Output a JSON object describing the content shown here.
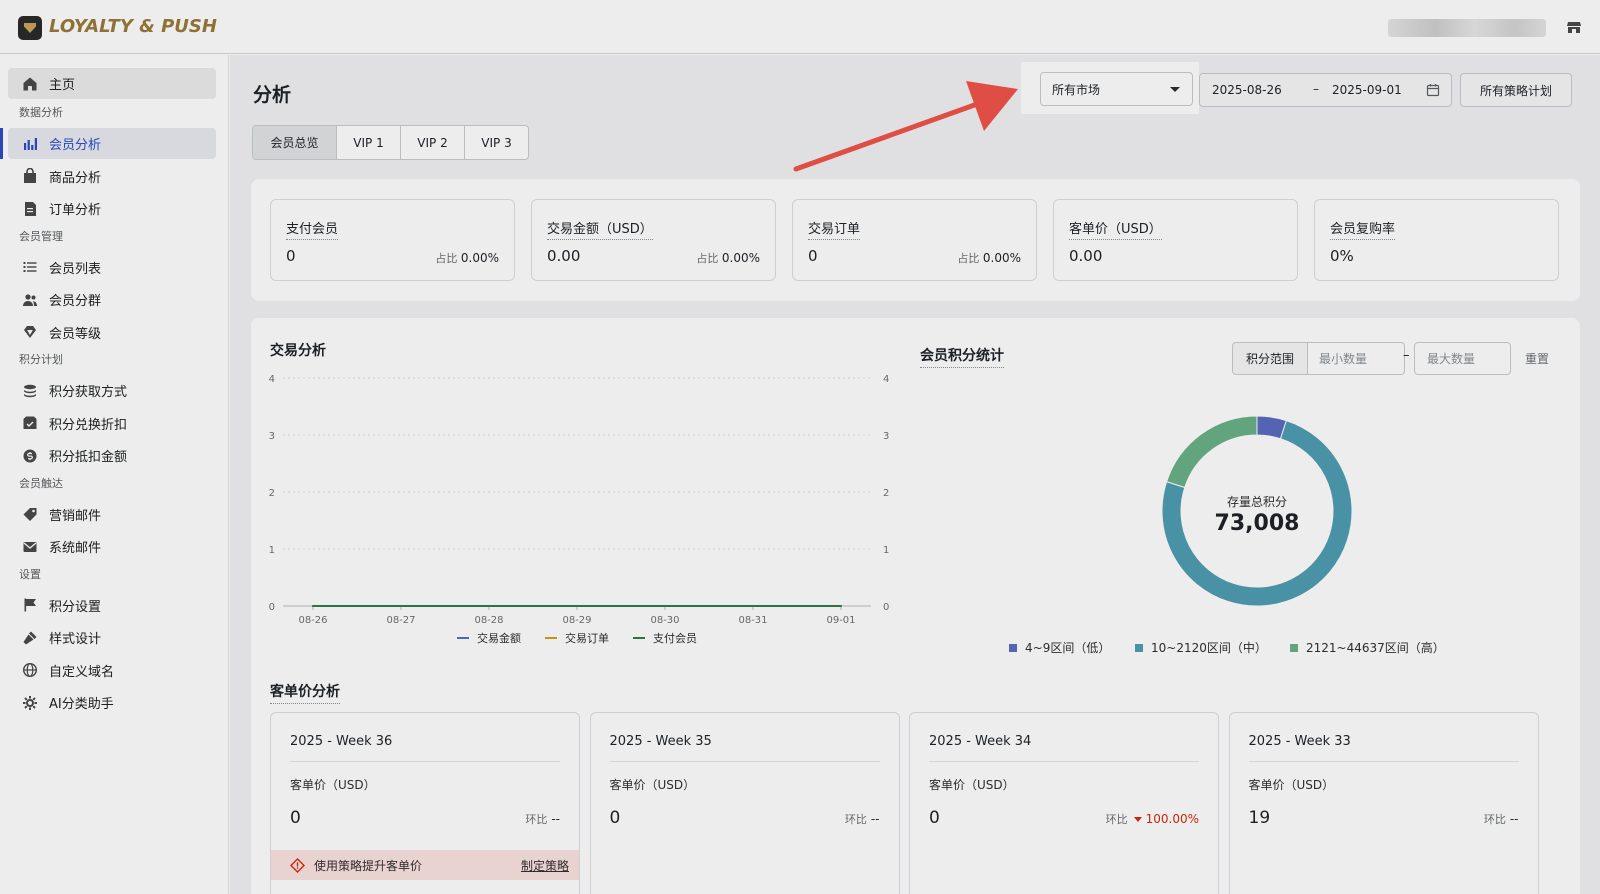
{
  "app": {
    "logo_text": "LOYALTY & PUSH"
  },
  "sidebar": {
    "home": "主页",
    "sections": [
      {
        "title": "数据分析",
        "items": [
          "会员分析",
          "商品分析",
          "订单分析"
        ]
      },
      {
        "title": "会员管理",
        "items": [
          "会员列表",
          "会员分群",
          "会员等级"
        ]
      },
      {
        "title": "积分计划",
        "items": [
          "积分获取方式",
          "积分兑换折扣",
          "积分抵扣金额"
        ]
      },
      {
        "title": "会员触达",
        "items": [
          "营销邮件",
          "系统邮件"
        ]
      },
      {
        "title": "设置",
        "items": [
          "积分设置",
          "样式设计",
          "自定义域名",
          "AI分类助手"
        ]
      }
    ],
    "active_item": "会员分析"
  },
  "header": {
    "title": "分析",
    "market_select": "所有市场",
    "date_start": "2025-08-26",
    "date_sep": "–",
    "date_end": "2025-09-01",
    "plan_button": "所有策略计划"
  },
  "tabs": [
    "会员总览",
    "VIP 1",
    "VIP 2",
    "VIP 3"
  ],
  "kpis": [
    {
      "label": "支付会员",
      "value": "0",
      "share_label": "占比",
      "share": "0.00%"
    },
    {
      "label": "交易金额（USD）",
      "value": "0.00",
      "share_label": "占比",
      "share": "0.00%"
    },
    {
      "label": "交易订单",
      "value": "0",
      "share_label": "占比",
      "share": "0.00%"
    },
    {
      "label": "客单价（USD）",
      "value": "0.00"
    },
    {
      "label": "会员复购率",
      "value": "0%"
    }
  ],
  "trade": {
    "title": "交易分析",
    "legend": [
      "交易金额",
      "交易订单",
      "支付会员"
    ],
    "colors": [
      "#5470c6",
      "#d4a017",
      "#2e7d4f"
    ]
  },
  "points": {
    "title": "会员积分统计",
    "range_label": "积分范围",
    "min_placeholder": "最小数量",
    "range_sep": "–",
    "max_placeholder": "最大数量",
    "reset": "重置",
    "center_label": "存量总积分",
    "center_value": "73,008",
    "legend": [
      "4~9区间（低）",
      "10~2120区间（中）",
      "2121~44637区间（高）"
    ],
    "colors": [
      "#5b6bc0",
      "#4f9db2",
      "#6ab187"
    ]
  },
  "aov": {
    "title": "客单价分析",
    "weeks": [
      {
        "title": "2025 - Week 36",
        "sub": "客单价（USD）",
        "value": "0",
        "change_label": "环比",
        "change": "--",
        "direction": "none"
      },
      {
        "title": "2025 - Week 35",
        "sub": "客单价（USD）",
        "value": "0",
        "change_label": "环比",
        "change": "--",
        "direction": "none"
      },
      {
        "title": "2025 - Week 34",
        "sub": "客单价（USD）",
        "value": "0",
        "change_label": "环比",
        "change": "100.00%",
        "direction": "down"
      },
      {
        "title": "2025 - Week 33",
        "sub": "客单价（USD）",
        "value": "19",
        "change_label": "环比",
        "change": "--",
        "direction": "none"
      }
    ],
    "tip_text": "使用策略提升客单价",
    "tip_link": "制定策略"
  },
  "chart_data": [
    {
      "type": "line",
      "x": [
        "08-26",
        "08-27",
        "08-28",
        "08-29",
        "08-30",
        "08-31",
        "09-01"
      ],
      "series": [
        {
          "name": "交易金额",
          "values": [
            0,
            0,
            0,
            0,
            0,
            0,
            0
          ]
        },
        {
          "name": "交易订单",
          "values": [
            0,
            0,
            0,
            0,
            0,
            0,
            0
          ]
        },
        {
          "name": "支付会员",
          "values": [
            0,
            0,
            0,
            0,
            0,
            0,
            0
          ]
        }
      ],
      "y_ticks": [
        "0",
        "1",
        "2",
        "3",
        "4"
      ],
      "ylim": [
        0,
        4
      ],
      "grid": true,
      "legend": "bottom"
    },
    {
      "type": "pie",
      "labels": [
        "4~9区间（低）",
        "10~2120区间（中）",
        "2121~44637区间（高）"
      ],
      "values": [
        5,
        75,
        20
      ],
      "donut": true
    }
  ]
}
